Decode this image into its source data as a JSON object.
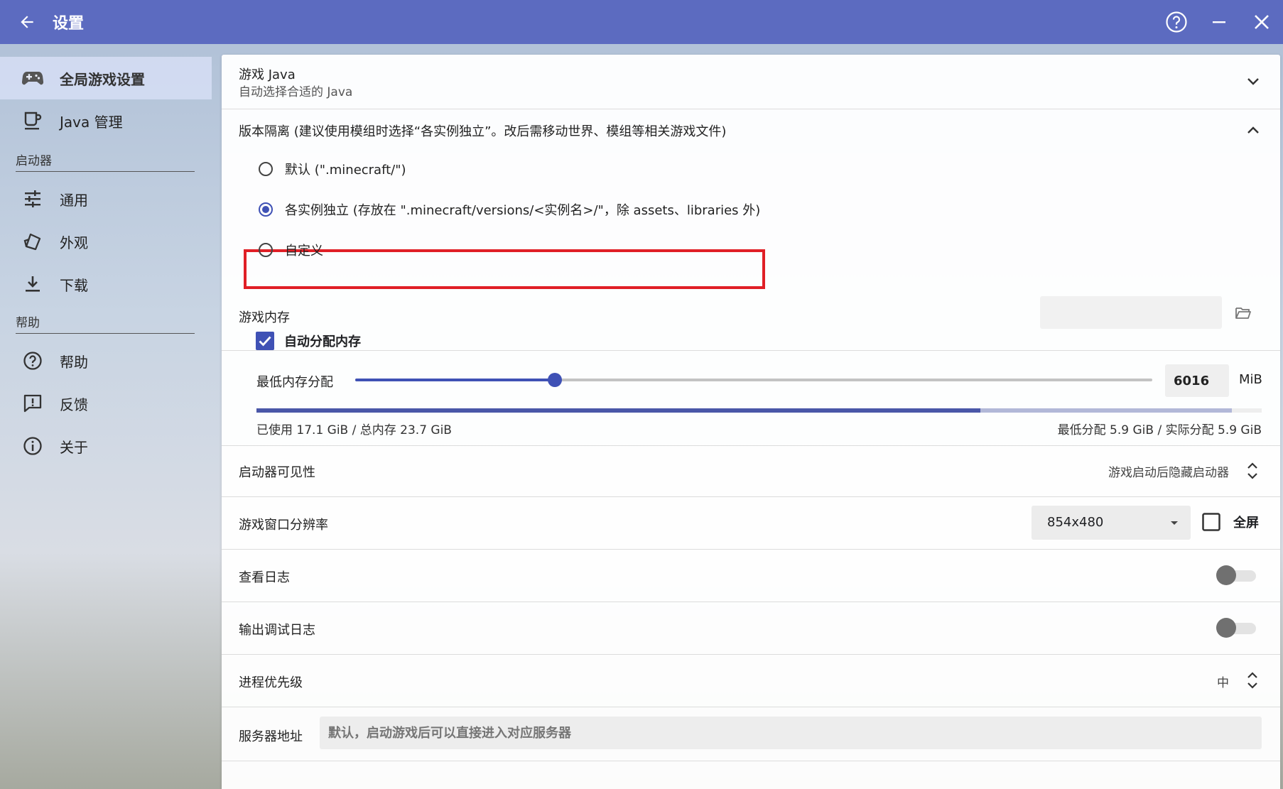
{
  "window": {
    "title": "设置"
  },
  "sidebar": {
    "items": [
      {
        "label": "全局游戏设置",
        "icon": "gamepad-icon",
        "active": true
      },
      {
        "label": "Java 管理",
        "icon": "java-cup-icon"
      }
    ],
    "sections": [
      {
        "title": "启动器",
        "items": [
          {
            "label": "通用",
            "icon": "sliders-icon"
          },
          {
            "label": "外观",
            "icon": "palette-icon"
          },
          {
            "label": "下载",
            "icon": "download-icon"
          }
        ]
      },
      {
        "title": "帮助",
        "items": [
          {
            "label": "帮助",
            "icon": "help-circle-icon"
          },
          {
            "label": "反馈",
            "icon": "feedback-icon"
          },
          {
            "label": "关于",
            "icon": "info-icon"
          }
        ]
      }
    ]
  },
  "java": {
    "title": "游戏 Java",
    "subtitle": "自动选择合适的 Java"
  },
  "isolation": {
    "title": "版本隔离 (建议使用模组时选择“各实例独立”。改后需移动世界、模组等相关游戏文件)",
    "options": [
      {
        "label": "默认 (\".minecraft/\")",
        "selected": false
      },
      {
        "label": "各实例独立 (存放在 \".minecraft/versions/<实例名>/\"，除 assets、libraries 外)",
        "selected": true
      },
      {
        "label": "自定义",
        "selected": false
      }
    ],
    "custom_path_value": ""
  },
  "memory": {
    "title": "游戏内存",
    "auto_label": "自动分配内存",
    "auto_checked": true,
    "min_label": "最低内存分配",
    "min_value": "6016",
    "unit": "MiB",
    "slider_fraction": 0.25,
    "used_fraction": 0.72,
    "allocated_fraction": 0.97,
    "used_text": "已使用 17.1 GiB / 总内存 23.7 GiB",
    "alloc_text": "最低分配 5.9 GiB / 实际分配 5.9 GiB"
  },
  "visibility": {
    "label": "启动器可见性",
    "value": "游戏启动后隐藏启动器"
  },
  "resolution": {
    "label": "游戏窗口分辨率",
    "value": "854x480",
    "fullscreen_label": "全屏",
    "fullscreen_checked": false
  },
  "log": {
    "label": "查看日志",
    "on": false
  },
  "debug_log": {
    "label": "输出调试日志",
    "on": false
  },
  "priority": {
    "label": "进程优先级",
    "value": "中"
  },
  "server": {
    "label": "服务器地址",
    "placeholder": "默认，启动游戏后可以直接进入对应服务器"
  },
  "colors": {
    "accent": "#3f51b5",
    "titlebar": "#5c6bc0",
    "highlight": "#e01f26"
  }
}
